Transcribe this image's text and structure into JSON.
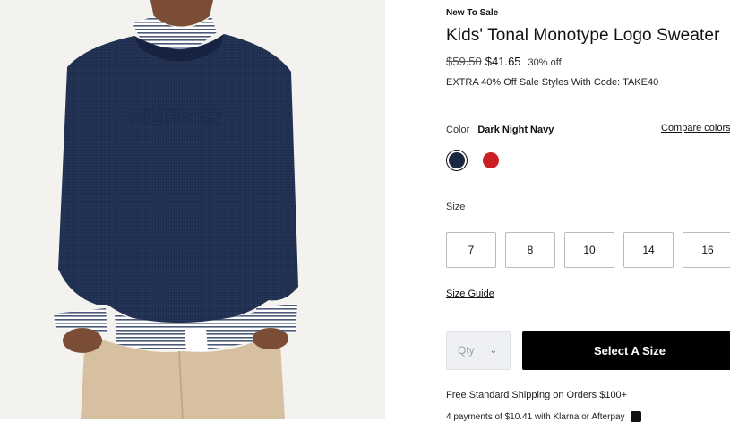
{
  "product": {
    "badge": "New To Sale",
    "title": "Kids' Tonal Monotype Logo Sweater",
    "price_original": "$59.50",
    "price_sale": "$41.65",
    "discount": "30% off",
    "promo": "EXTRA 40% Off Sale Styles With Code: TAKE40"
  },
  "color": {
    "label": "Color",
    "selected": "Dark Night Navy",
    "compare_link": "Compare colors",
    "swatches": [
      {
        "name": "navy-swatch",
        "hex": "#1b2740"
      },
      {
        "name": "red-swatch",
        "hex": "#cc1f25"
      }
    ]
  },
  "size": {
    "label": "Size",
    "options": [
      "7",
      "8",
      "10",
      "14",
      "16"
    ],
    "guide_link": "Size Guide"
  },
  "cart": {
    "qty_placeholder": "Qty",
    "cta_label": "Select A Size"
  },
  "shipping": {
    "message": "Free Standard Shipping on Orders $100+",
    "installments": "4 payments of $10.41 with Klarna or Afterpay"
  },
  "image": {
    "sweater_logo_text": "HILFIGER"
  },
  "colors": {
    "accent": "#000000",
    "swatch_navy": "#1b2740",
    "swatch_red": "#cc1f25"
  }
}
